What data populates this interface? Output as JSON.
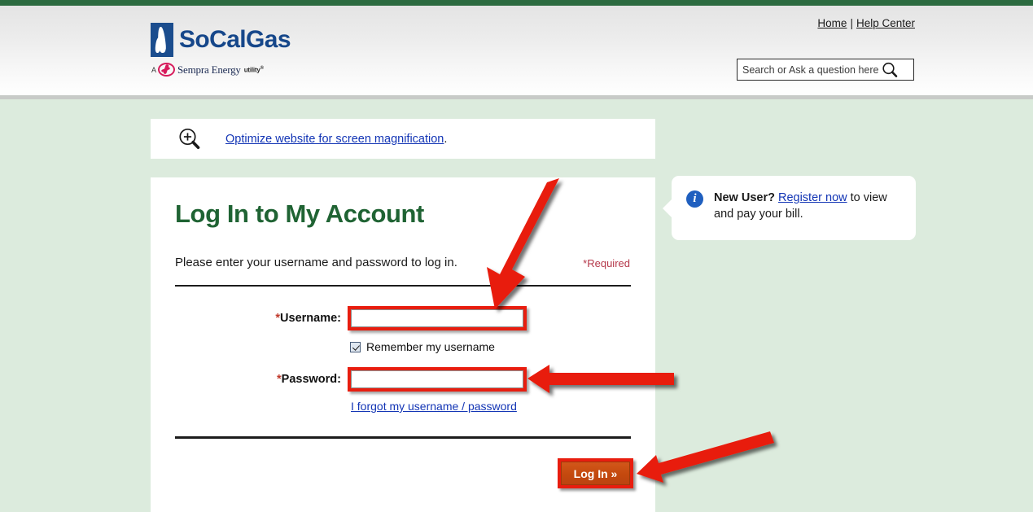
{
  "brand": {
    "logo_text": "SoCalGas",
    "tagline_prefix": "A",
    "tagline_name": "Sempra Energy",
    "tagline_suffix": "utility",
    "logo_icon": "flame-icon",
    "sempra_icon": "sempra-runner-icon"
  },
  "header": {
    "home_link": "Home",
    "separator": "|",
    "help_link": "Help Center",
    "search": {
      "placeholder": "Search or Ask a question here",
      "value": "",
      "icon": "search-icon"
    }
  },
  "notice": {
    "icon": "magnifier-plus-icon",
    "link_text": "Optimize website for screen magnification",
    "trailing": "."
  },
  "login": {
    "title": "Log In to My Account",
    "instruction": "Please enter your username and password to log in.",
    "required_note": "*Required",
    "username": {
      "label_star": "*",
      "label": "Username:",
      "value": "",
      "placeholder": ""
    },
    "remember": {
      "label": "Remember my username",
      "checked": true
    },
    "password": {
      "label_star": "*",
      "label": "Password:",
      "value": "",
      "placeholder": ""
    },
    "forgot_link": "I forgot my username / password",
    "submit_label": "Log In »"
  },
  "callout": {
    "icon": "info-icon",
    "heading": "New User?",
    "link_text": "Register now",
    "body_text": " to view and pay your bill."
  },
  "colors": {
    "top_bar_green": "#2c6b40",
    "page_green": "#dcebdd",
    "title_green": "#1f6333",
    "link_blue": "#1335b5",
    "required_red": "#b5384a",
    "button_orange": "#c4490e",
    "annotation_red": "#e81d0f",
    "logo_blue": "#16478a",
    "sempra_pink": "#d71a5b"
  },
  "annotations": {
    "arrow_username": "arrow-pointing-to-username-field",
    "arrow_password": "arrow-pointing-to-password-field",
    "arrow_login": "arrow-pointing-to-login-button",
    "box_username": "highlight-box-username",
    "box_password": "highlight-box-password",
    "box_login": "highlight-box-login-button"
  }
}
